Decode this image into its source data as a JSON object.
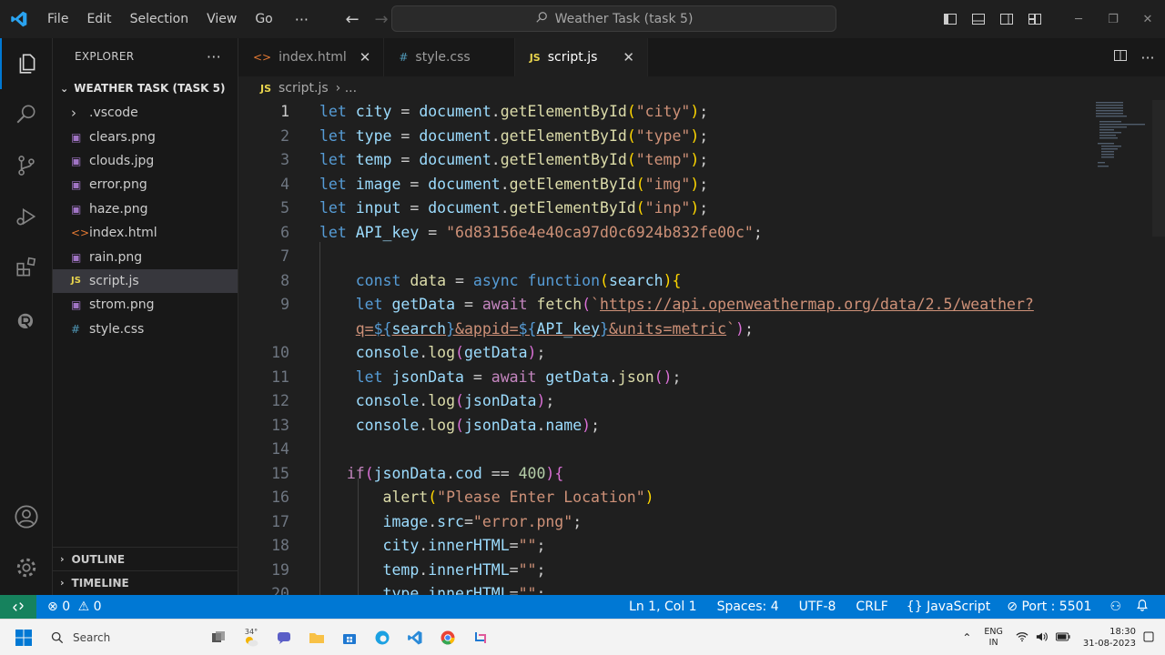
{
  "titlebar": {
    "menu": [
      "File",
      "Edit",
      "Selection",
      "View",
      "Go"
    ],
    "more": "···",
    "search": "Weather Task (task 5)"
  },
  "sidebar": {
    "header": "EXPLORER",
    "folder": "WEATHER TASK (TASK 5)",
    "items": [
      {
        "label": ".vscode",
        "icon": "chevron-right-icon"
      },
      {
        "label": "clears.png",
        "icon": "image-file-icon"
      },
      {
        "label": "clouds.jpg",
        "icon": "image-file-icon"
      },
      {
        "label": "error.png",
        "icon": "image-file-icon"
      },
      {
        "label": "haze.png",
        "icon": "image-file-icon"
      },
      {
        "label": "index.html",
        "icon": "html-file-icon"
      },
      {
        "label": "rain.png",
        "icon": "image-file-icon"
      },
      {
        "label": "script.js",
        "icon": "js-file-icon"
      },
      {
        "label": "strom.png",
        "icon": "image-file-icon"
      },
      {
        "label": "style.css",
        "icon": "css-file-icon"
      }
    ],
    "outline": "OUTLINE",
    "timeline": "TIMELINE"
  },
  "tabs": [
    {
      "label": "index.html",
      "icon": "<>",
      "close": "✕"
    },
    {
      "label": "style.css",
      "icon": "#"
    },
    {
      "label": "script.js",
      "icon": "JS",
      "close": "✕"
    }
  ],
  "breadcrumb": {
    "file": "script.js",
    "rest": "› ..."
  },
  "editor": {
    "line_numbers": [
      "1",
      "2",
      "3",
      "4",
      "5",
      "6",
      "7",
      "8",
      "9",
      "",
      "10",
      "11",
      "12",
      "13",
      "14",
      "15",
      "16",
      "17",
      "18",
      "19",
      "20"
    ]
  },
  "statusbar": {
    "problems": "0",
    "warnings": "0",
    "position": "Ln 1, Col 1",
    "spaces": "Spaces: 4",
    "encoding": "UTF-8",
    "eol": "CRLF",
    "language": "JavaScript",
    "port": "Port : 5501"
  },
  "taskbar": {
    "search": "Search",
    "weather": "34°",
    "lang_1": "ENG",
    "lang_2": "IN",
    "time": "18:30",
    "date": "31-08-2023"
  },
  "colors": {
    "accent": "#0078d4",
    "remote": "#16825d",
    "keyword": "#569cd6",
    "string": "#ce9178",
    "function": "#dcdcaa"
  }
}
